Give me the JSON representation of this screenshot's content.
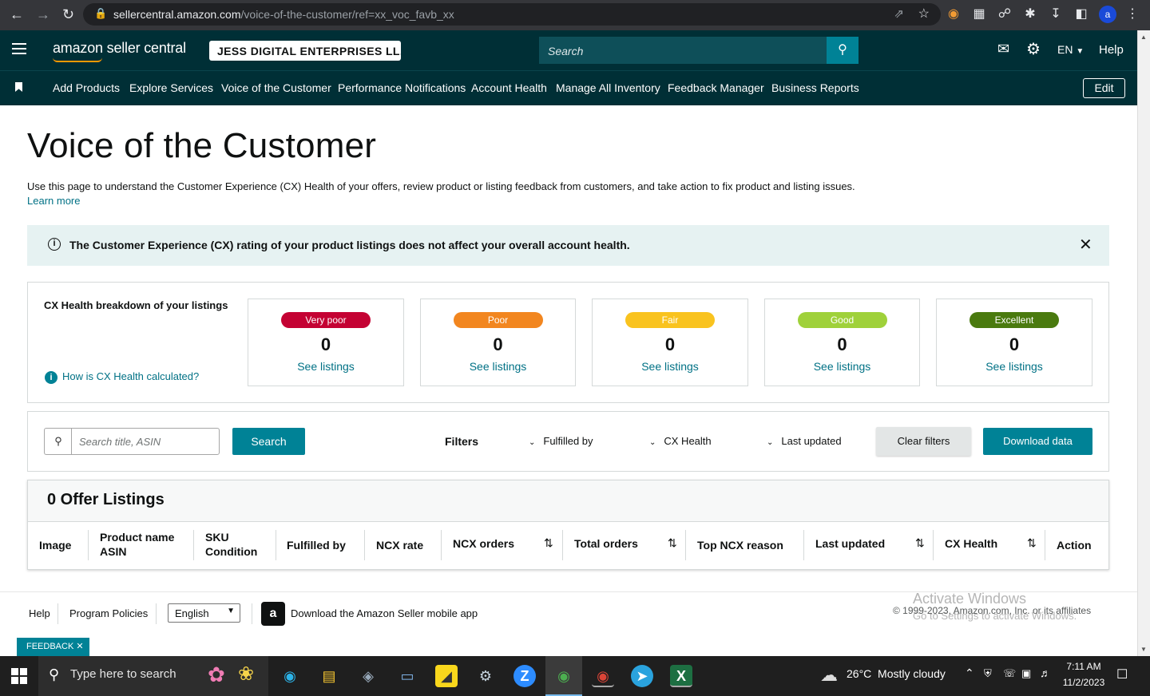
{
  "browser": {
    "url_host": "sellercentral.amazon.com",
    "url_path": "/voice-of-the-customer/ref=xx_voc_favb_xx",
    "profile": "a"
  },
  "header": {
    "logo": "amazon seller central",
    "account": "JESS DIGITAL ENTERPRISES LL...",
    "search_placeholder": "Search",
    "lang": "EN",
    "help": "Help"
  },
  "nav": {
    "items": [
      "Add Products",
      "Explore Services",
      "Voice of the Customer",
      "Performance Notifications",
      "Account Health",
      "Manage All Inventory",
      "Feedback Manager",
      "Business Reports"
    ],
    "edit": "Edit"
  },
  "page": {
    "title": "Voice of the Customer",
    "description": "Use this page to understand the Customer Experience (CX) Health of your offers, review product or listing feedback from customers, and take action to fix product and listing issues.",
    "learn_more": "Learn more",
    "alert": "The Customer Experience (CX) rating of your product listings does not affect your overall account health."
  },
  "health": {
    "heading": "CX Health breakdown of your listings",
    "how_link": "How is CX Health calculated?",
    "cards": [
      {
        "label": "Very poor",
        "count": "0",
        "link": "See listings",
        "color": "#c40233"
      },
      {
        "label": "Poor",
        "count": "0",
        "link": "See listings",
        "color": "#f2861f"
      },
      {
        "label": "Fair",
        "count": "0",
        "link": "See listings",
        "color": "#f9c31f"
      },
      {
        "label": "Good",
        "count": "0",
        "link": "See listings",
        "color": "#9fd13a"
      },
      {
        "label": "Excellent",
        "count": "0",
        "link": "See listings",
        "color": "#4a7a0f"
      }
    ]
  },
  "filters": {
    "search_placeholder": "Search title, ASIN",
    "search_button": "Search",
    "filters_label": "Filters",
    "fulfilled_by": "Fulfilled by",
    "cx_health": "CX Health",
    "last_updated": "Last updated",
    "clear": "Clear filters",
    "download": "Download data"
  },
  "listings": {
    "title": "0 Offer Listings",
    "columns": {
      "image": "Image",
      "product_name": "Product name",
      "asin": "ASIN",
      "sku": "SKU",
      "condition": "Condition",
      "fulfilled_by": "Fulfilled by",
      "ncx_rate": "NCX rate",
      "ncx_orders": "NCX orders",
      "total_orders": "Total orders",
      "top_reason": "Top NCX reason",
      "last_updated": "Last updated",
      "cx_health": "CX Health",
      "action": "Action"
    }
  },
  "footer": {
    "help": "Help",
    "policies": "Program Policies",
    "language": "English",
    "app": "Download the Amazon Seller mobile app",
    "copyright": "© 1999-2023, Amazon.com, Inc. or its affiliates",
    "watermark1": "Activate Windows",
    "watermark2": "Go to Settings to activate Windows.",
    "feedback": "FEEDBACK"
  },
  "taskbar": {
    "search": "Type here to search",
    "weather": "26°C  Mostly cloudy",
    "time": "7:11 AM",
    "date": "11/2/2023"
  },
  "colors": {
    "header_bg": "#002f36",
    "teal": "#008296",
    "link": "#007185",
    "alert_bg": "#e6f2f2"
  }
}
